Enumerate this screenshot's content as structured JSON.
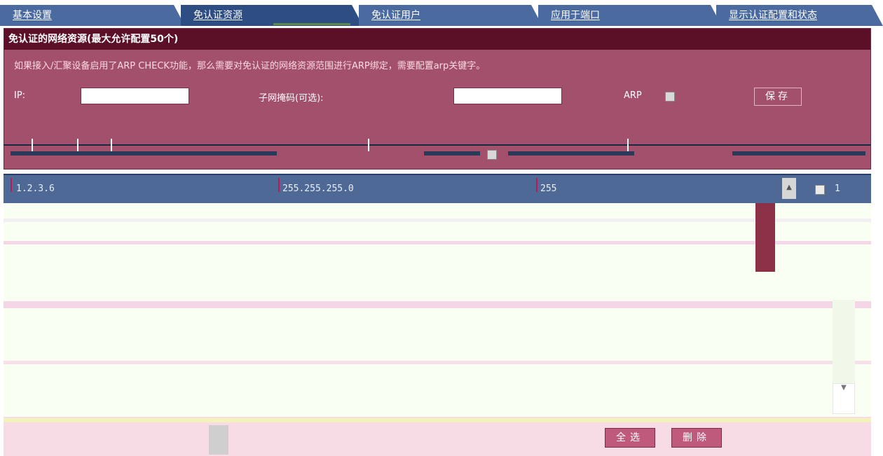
{
  "tabs": [
    {
      "label": "基本设置"
    },
    {
      "label": "免认证资源"
    },
    {
      "label": "免认证用户"
    },
    {
      "label": "应用于端口"
    },
    {
      "label": "显示认证配置和状态"
    }
  ],
  "panel": {
    "title": "免认证的网络资源(最大允许配置50个)",
    "notice": "如果接入/汇聚设备启用了ARP CHECK功能，那么需要对免认证的网络资源范围进行ARP绑定，需要配置arp关键字。",
    "ip_label": "IP:",
    "ip_value": "",
    "mask_label": "子网掩码(可选):",
    "mask_value": "",
    "arp_label": "ARP",
    "save_label": "保存"
  },
  "rows": [
    {
      "ip": "1.2.3.6",
      "mask": "255.255.255.0",
      "arp": "",
      "extra": "255",
      "index": "1"
    }
  ],
  "footer": {
    "select_all_label": "全选",
    "delete_label": "删除"
  },
  "colors": {
    "tab": "#4a6aa0",
    "panel": "#a2506b",
    "panel_title": "#5c1027",
    "row": "#4f6996"
  }
}
